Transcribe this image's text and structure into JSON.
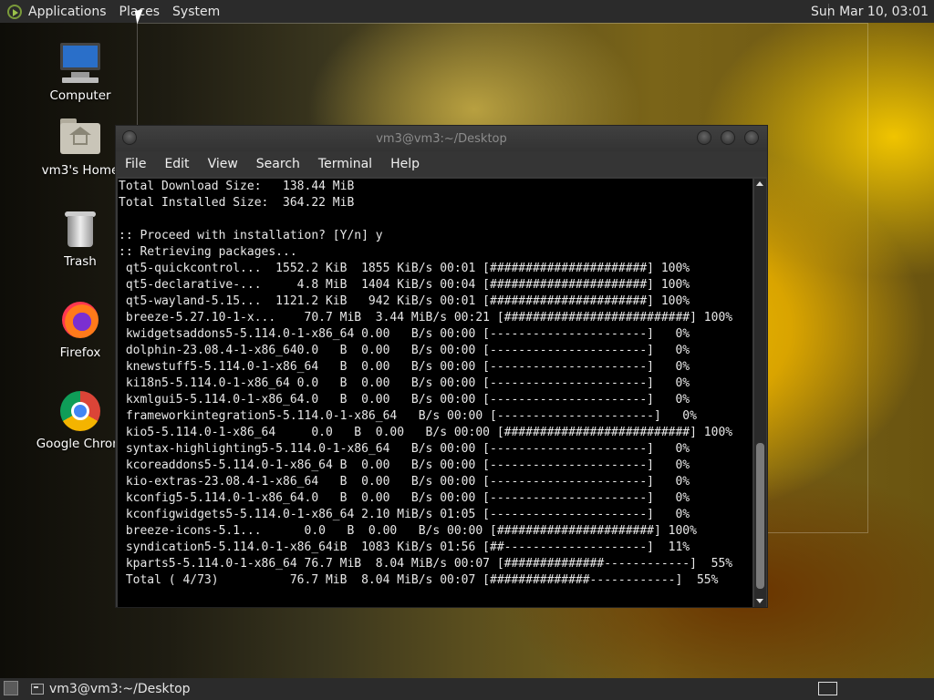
{
  "top_panel": {
    "menus": [
      "Applications",
      "Places",
      "System"
    ],
    "clock": "Sun Mar 10, 03:01"
  },
  "desktop_icons": [
    {
      "label": "Computer",
      "icon": "computer-icon"
    },
    {
      "label": "vm3's Home",
      "icon": "home-folder-icon"
    },
    {
      "label": "Trash",
      "icon": "trash-icon"
    },
    {
      "label": "Firefox",
      "icon": "firefox-icon"
    },
    {
      "label": "Google Chrom",
      "icon": "chrome-icon"
    }
  ],
  "terminal": {
    "title": "vm3@vm3:~/Desktop",
    "menu": [
      "File",
      "Edit",
      "View",
      "Search",
      "Terminal",
      "Help"
    ],
    "lines": [
      "Total Download Size:   138.44 MiB",
      "Total Installed Size:  364.22 MiB",
      "",
      ":: Proceed with installation? [Y/n] y",
      ":: Retrieving packages...",
      " qt5-quickcontrol...  1552.2 KiB  1855 KiB/s 00:01 [######################] 100%",
      " qt5-declarative-...     4.8 MiB  1404 KiB/s 00:04 [######################] 100%",
      " qt5-wayland-5.15...  1121.2 KiB   942 KiB/s 00:01 [######################] 100%",
      " breeze-5.27.10-1-x...    70.7 MiB  3.44 MiB/s 00:21 [##########################] 100%",
      " kwidgetsaddons5-5.114.0-1-x86_64 0.00   B/s 00:00 [----------------------]   0%",
      " dolphin-23.08.4-1-x86_640.0   B  0.00   B/s 00:00 [----------------------]   0%",
      " knewstuff5-5.114.0-1-x86_64   B  0.00   B/s 00:00 [----------------------]   0%",
      " ki18n5-5.114.0-1-x86_64 0.0   B  0.00   B/s 00:00 [----------------------]   0%",
      " kxmlgui5-5.114.0-1-x86_64.0   B  0.00   B/s 00:00 [----------------------]   0%",
      " frameworkintegration5-5.114.0-1-x86_64   B/s 00:00 [----------------------]   0%",
      " kio5-5.114.0-1-x86_64     0.0   B  0.00   B/s 00:00 [##########################] 100%",
      " syntax-highlighting5-5.114.0-1-x86_64   B/s 00:00 [----------------------]   0%",
      " kcoreaddons5-5.114.0-1-x86_64 B  0.00   B/s 00:00 [----------------------]   0%",
      " kio-extras-23.08.4-1-x86_64   B  0.00   B/s 00:00 [----------------------]   0%",
      " kconfig5-5.114.0-1-x86_64.0   B  0.00   B/s 00:00 [----------------------]   0%",
      " kconfigwidgets5-5.114.0-1-x86_64 2.10 MiB/s 01:05 [----------------------]   0%",
      " breeze-icons-5.1...      0.0   B  0.00   B/s 00:00 [######################] 100%",
      " syndication5-5.114.0-1-x86_64iB  1083 KiB/s 01:56 [##--------------------]  11%",
      " kparts5-5.114.0-1-x86_64 76.7 MiB  8.04 MiB/s 00:07 [##############------------]  55%",
      " Total ( 4/73)          76.7 MiB  8.04 MiB/s 00:07 [##############------------]  55%"
    ]
  },
  "bottom_panel": {
    "task_label": "vm3@vm3:~/Desktop"
  }
}
